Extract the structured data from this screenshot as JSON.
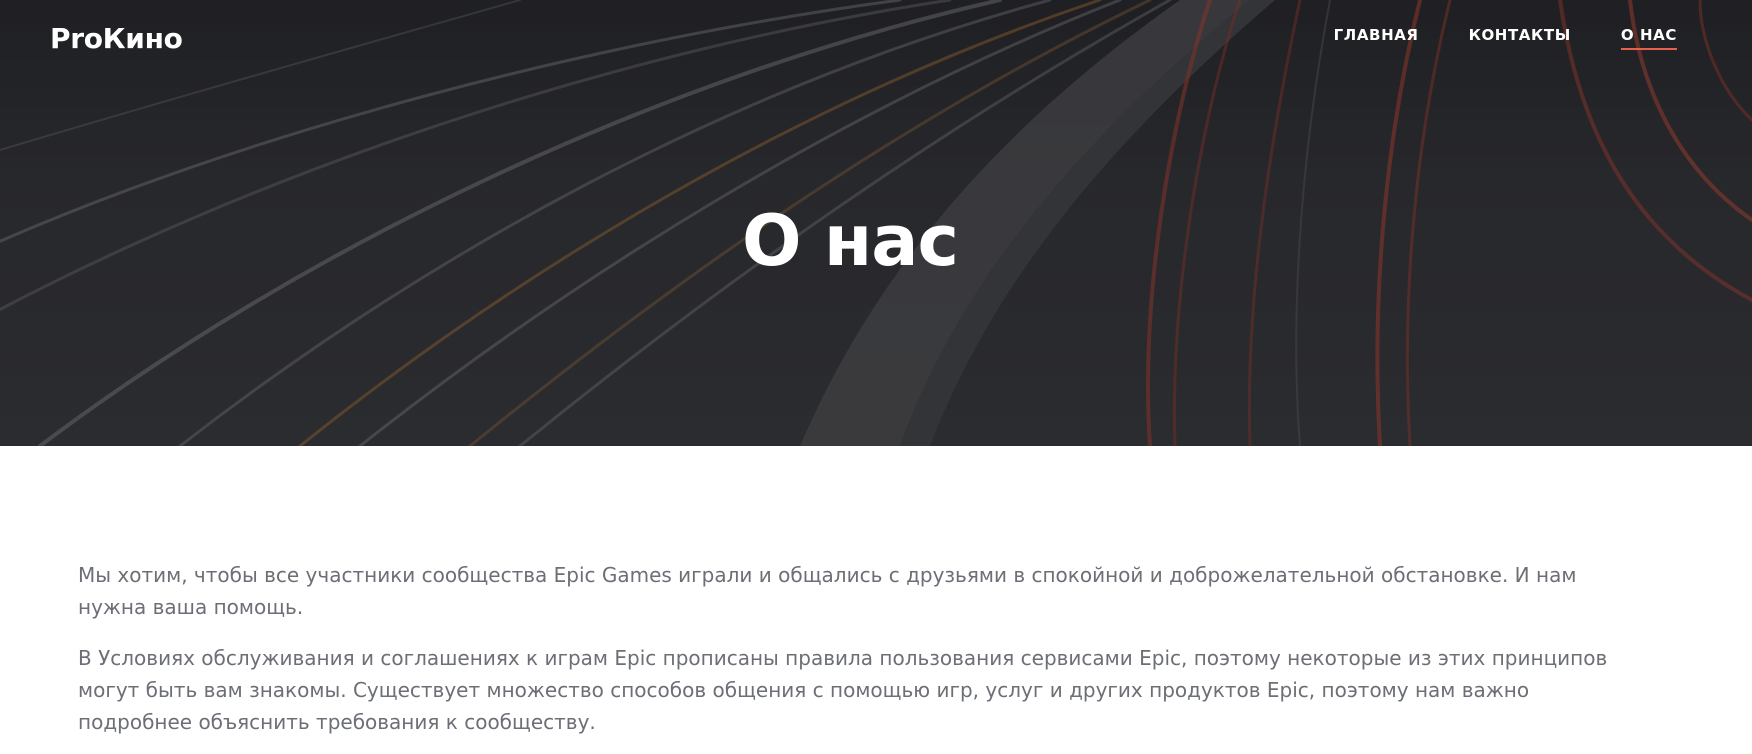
{
  "header": {
    "brand": "ProКино",
    "nav": [
      {
        "label": "ГЛАВНАЯ",
        "active": false
      },
      {
        "label": "КОНТАКТЫ",
        "active": false
      },
      {
        "label": "О НАС",
        "active": true
      }
    ]
  },
  "hero": {
    "title": "О нас"
  },
  "content": {
    "paragraphs": [
      "Мы хотим, чтобы все участники сообщества Epic Games играли и общались с друзьями в спокойной и доброжелательной обстановке. И нам нужна ваша помощь.",
      "В Условиях обслуживания и соглашениях к играм Epic прописаны правила пользования сервисами Epic, поэтому некоторые из этих принципов могут быть вам знакомы. Существует множество способов общения с помощью игр, услуг и других продуктов Epic, поэтому нам важно подробнее объяснить требования к сообществу."
    ]
  },
  "colors": {
    "nav_active_underline": "#e7604d",
    "text_muted": "#6c6f76",
    "hero_overlay": "#2a2b2f"
  }
}
